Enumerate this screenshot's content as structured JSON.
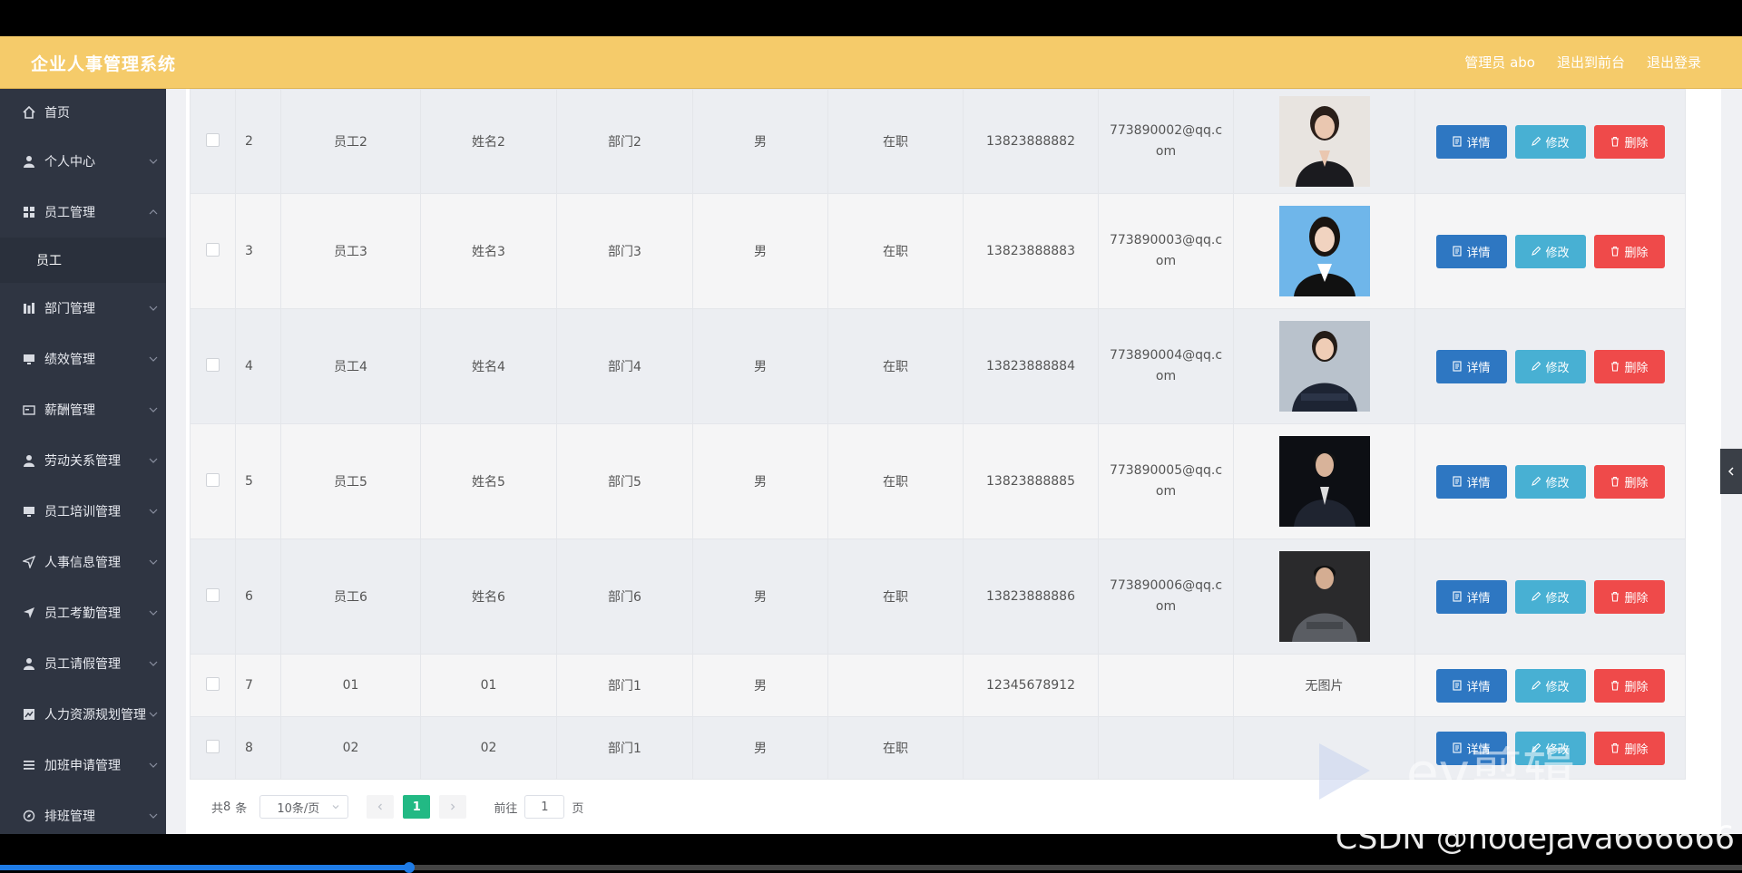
{
  "header": {
    "title": "企业人事管理系统",
    "admin_label": "管理员 abo",
    "front_label": "退出到前台",
    "logout_label": "退出登录"
  },
  "sidebar": {
    "items": [
      {
        "label": "首页",
        "icon": "home-icon"
      },
      {
        "label": "个人中心",
        "icon": "user-icon"
      },
      {
        "label": "员工管理",
        "icon": "grid-icon"
      },
      {
        "label": "部门管理",
        "icon": "building-icon"
      },
      {
        "label": "绩效管理",
        "icon": "monitor-icon"
      },
      {
        "label": "薪酬管理",
        "icon": "card-icon"
      },
      {
        "label": "劳动关系管理",
        "icon": "user-icon"
      },
      {
        "label": "员工培训管理",
        "icon": "monitor-icon"
      },
      {
        "label": "人事信息管理",
        "icon": "send-icon"
      },
      {
        "label": "员工考勤管理",
        "icon": "send-icon"
      },
      {
        "label": "员工请假管理",
        "icon": "user-icon"
      },
      {
        "label": "人力资源规划管理",
        "icon": "chart-icon"
      },
      {
        "label": "加班申请管理",
        "icon": "list-icon"
      },
      {
        "label": "排班管理",
        "icon": "compass-icon"
      }
    ],
    "sub_item": "员工"
  },
  "table": {
    "rows": [
      {
        "index": "2",
        "emp_no": "员工2",
        "name": "姓名2",
        "dept": "部门2",
        "gender": "男",
        "status": "在职",
        "phone": "13823888882",
        "email": "773890002@qq.com",
        "photo": "photo-woman-black-suit"
      },
      {
        "index": "3",
        "emp_no": "员工3",
        "name": "姓名3",
        "dept": "部门3",
        "gender": "男",
        "status": "在职",
        "phone": "13823888883",
        "email": "773890003@qq.com",
        "photo": "photo-woman-blue-background"
      },
      {
        "index": "4",
        "emp_no": "员工4",
        "name": "姓名4",
        "dept": "部门4",
        "gender": "男",
        "status": "在职",
        "phone": "13823888884",
        "email": "773890004@qq.com",
        "photo": "photo-woman-arms-crossed"
      },
      {
        "index": "5",
        "emp_no": "员工5",
        "name": "姓名5",
        "dept": "部门5",
        "gender": "男",
        "status": "在职",
        "phone": "13823888885",
        "email": "773890005@qq.com",
        "photo": "photo-man-dark-suit"
      },
      {
        "index": "6",
        "emp_no": "员工6",
        "name": "姓名6",
        "dept": "部门6",
        "gender": "男",
        "status": "在职",
        "phone": "13823888886",
        "email": "773890006@qq.com",
        "photo": "photo-man-grey-suit"
      },
      {
        "index": "7",
        "emp_no": "01",
        "name": "01",
        "dept": "部门1",
        "gender": "男",
        "status": "",
        "phone": "12345678912",
        "email": "",
        "photo_text": "无图片"
      },
      {
        "index": "8",
        "emp_no": "02",
        "name": "02",
        "dept": "部门1",
        "gender": "男",
        "status": "在职",
        "phone": "",
        "email": "",
        "photo_text": ""
      }
    ],
    "actions": {
      "detail": "详情",
      "edit": "修改",
      "delete": "删除"
    }
  },
  "pagination": {
    "total_prefix": "共",
    "total": "8",
    "total_suffix": "条",
    "page_size": "10条/页",
    "current_page": "1",
    "goto_label": "前往",
    "goto_value": "1",
    "page_unit": "页"
  },
  "watermarks": {
    "csdn": "CSDN @nodejava666666",
    "ev": "ev剪辑"
  },
  "colors": {
    "header": "#f5cb6a",
    "sidebar": "#2f3542",
    "detail": "#2e77c2",
    "edit": "#48b0d3",
    "delete": "#ef4a4a",
    "page_active": "#22b984"
  },
  "video_progress": 0.235
}
